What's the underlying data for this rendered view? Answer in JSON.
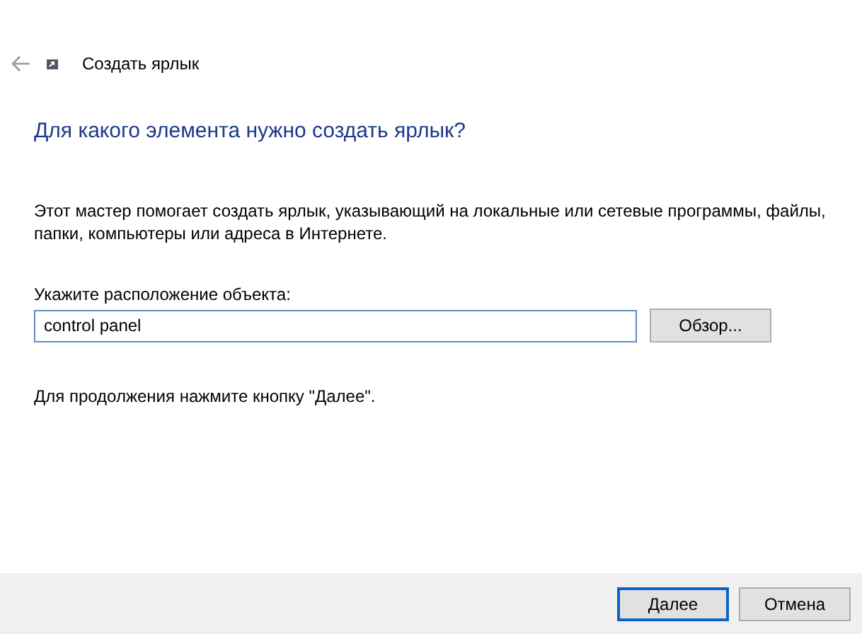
{
  "window": {
    "title": "Создать ярлык"
  },
  "heading": "Для какого элемента нужно создать ярлык?",
  "description": "Этот мастер помогает создать ярлык, указывающий на локальные или сетевые программы, файлы, папки, компьютеры или адреса в Интернете.",
  "location": {
    "label": "Укажите расположение объекта:",
    "value": "control panel",
    "browse": "Обзор..."
  },
  "hint": "Для продолжения нажмите кнопку \"Далее\".",
  "buttons": [
    {
      "label": "Далее",
      "selected": true
    },
    {
      "label": "Отмена",
      "selected": false
    }
  ]
}
